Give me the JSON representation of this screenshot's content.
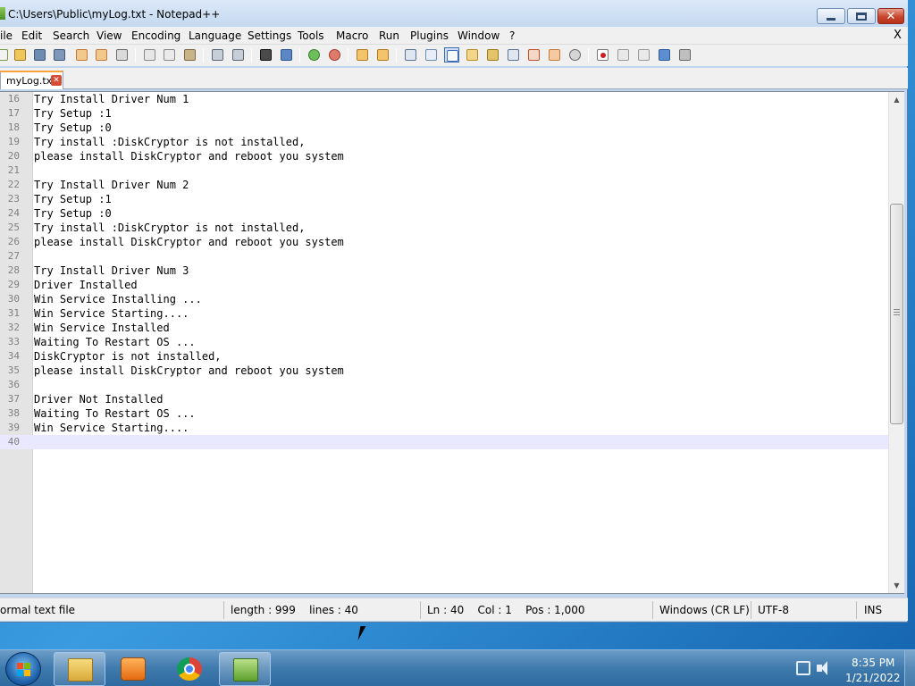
{
  "window": {
    "title": "C:\\Users\\Public\\myLog.txt - Notepad++",
    "close_doc_label": "X"
  },
  "menu": {
    "items": [
      "ile",
      "Edit",
      "Search",
      "View",
      "Encoding",
      "Language",
      "Settings",
      "Tools",
      "Macro",
      "Run",
      "Plugins",
      "Window",
      "?"
    ]
  },
  "toolbar": {
    "icons": [
      "new-file-icon",
      "open-file-icon",
      "save-icon",
      "save-all-icon",
      "close-icon",
      "close-all-icon",
      "print-icon",
      "cut-icon",
      "copy-icon",
      "paste-icon",
      "undo-icon",
      "redo-icon",
      "find-icon",
      "replace-icon",
      "zoom-in-icon",
      "zoom-out-icon",
      "sync-vertical-icon",
      "sync-horizontal-icon",
      "word-wrap-icon",
      "show-all-chars-icon",
      "indent-guide-icon",
      "doc-map-icon",
      "function-list-icon",
      "doc-switcher-icon",
      "folder-workspace-icon",
      "monitoring-icon",
      "record-macro-icon",
      "stop-recording-icon",
      "playback-icon",
      "run-macro-multiple-icon",
      "save-macro-icon"
    ]
  },
  "tab": {
    "label": "myLog.txt",
    "close_glyph": "✕"
  },
  "editor": {
    "lines": [
      {
        "n": "16",
        "text": "Try Install Driver Num 1"
      },
      {
        "n": "17",
        "text": "Try Setup :1"
      },
      {
        "n": "18",
        "text": "Try Setup :0"
      },
      {
        "n": "19",
        "text": "Try install :DiskCryptor is not installed,"
      },
      {
        "n": "20",
        "text": "please install DiskCryptor and reboot you system"
      },
      {
        "n": "21",
        "text": ""
      },
      {
        "n": "22",
        "text": "Try Install Driver Num 2"
      },
      {
        "n": "23",
        "text": "Try Setup :1"
      },
      {
        "n": "24",
        "text": "Try Setup :0"
      },
      {
        "n": "25",
        "text": "Try install :DiskCryptor is not installed,"
      },
      {
        "n": "26",
        "text": "please install DiskCryptor and reboot you system"
      },
      {
        "n": "27",
        "text": ""
      },
      {
        "n": "28",
        "text": "Try Install Driver Num 3"
      },
      {
        "n": "29",
        "text": "Driver Installed"
      },
      {
        "n": "30",
        "text": "Win Service Installing ..."
      },
      {
        "n": "31",
        "text": "Win Service Starting...."
      },
      {
        "n": "32",
        "text": "Win Service Installed"
      },
      {
        "n": "33",
        "text": "Waiting To Restart OS ..."
      },
      {
        "n": "34",
        "text": "DiskCryptor is not installed,"
      },
      {
        "n": "35",
        "text": "please install DiskCryptor and reboot you system"
      },
      {
        "n": "36",
        "text": ""
      },
      {
        "n": "37",
        "text": "Driver Not Installed"
      },
      {
        "n": "38",
        "text": "Waiting To Restart OS ..."
      },
      {
        "n": "39",
        "text": "Win Service Starting...."
      },
      {
        "n": "40",
        "text": ""
      }
    ],
    "current_line": "40"
  },
  "status": {
    "file_type": "ormal text file",
    "length_lines": "length : 999    lines : 40",
    "position": "Ln : 40    Col : 1    Pos : 1,000",
    "eol": "Windows (CR LF)",
    "encoding": "UTF-8",
    "mode": "INS"
  },
  "taskbar": {
    "pinned": [
      "explorer-icon",
      "media-player-icon",
      "chrome-icon",
      "notepadpp-icon"
    ],
    "active": "notepadpp-icon",
    "clock_time": "8:35 PM",
    "clock_date": "1/21/2022"
  },
  "colors": {
    "title_bar": "#c4d9f1",
    "current_line_highlight": "#e8e8ff",
    "gutter": "#e4e4e4",
    "taskbar": "#3f7aad",
    "close_button": "#c8462d"
  }
}
